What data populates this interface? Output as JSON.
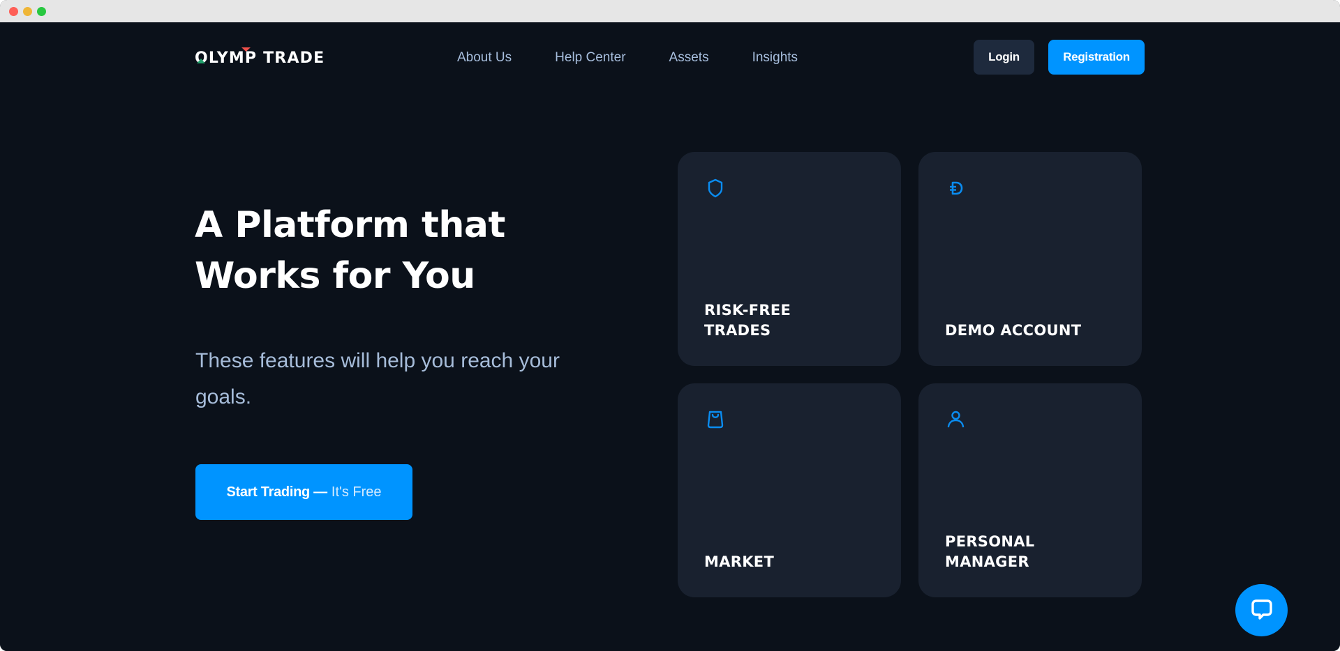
{
  "window": {
    "controls": [
      "close",
      "minimize",
      "maximize"
    ]
  },
  "header": {
    "logo": {
      "text": "OLYMP TRADE",
      "accent_up": "#22a06b",
      "accent_down": "#f0504a"
    },
    "nav": [
      {
        "label": "About Us"
      },
      {
        "label": "Help Center"
      },
      {
        "label": "Assets"
      },
      {
        "label": "Insights"
      }
    ],
    "login_label": "Login",
    "register_label": "Registration"
  },
  "hero": {
    "title_line1": "A Platform that",
    "title_line2": "Works for You",
    "subtitle": "These features will help you reach your goals.",
    "cta_strong": "Start Trading —",
    "cta_light": "It's Free"
  },
  "features": [
    {
      "icon": "shield-icon",
      "label_line1": "RISK-FREE",
      "label_line2": "TRADES"
    },
    {
      "icon": "demo-currency-icon",
      "label_line1": "DEMO ACCOUNT",
      "label_line2": ""
    },
    {
      "icon": "shopping-bag-icon",
      "label_line1": "MARKET",
      "label_line2": ""
    },
    {
      "icon": "person-icon",
      "label_line1": "PERSONAL",
      "label_line2": "MANAGER"
    }
  ],
  "chat": {
    "icon": "chat-bubble-icon"
  },
  "colors": {
    "background": "#0b111a",
    "card": "#19212f",
    "accent": "#0094ff",
    "icon": "#0a8cf0",
    "nav_text": "#a7bedd",
    "login_bg": "#1e2a3d"
  }
}
